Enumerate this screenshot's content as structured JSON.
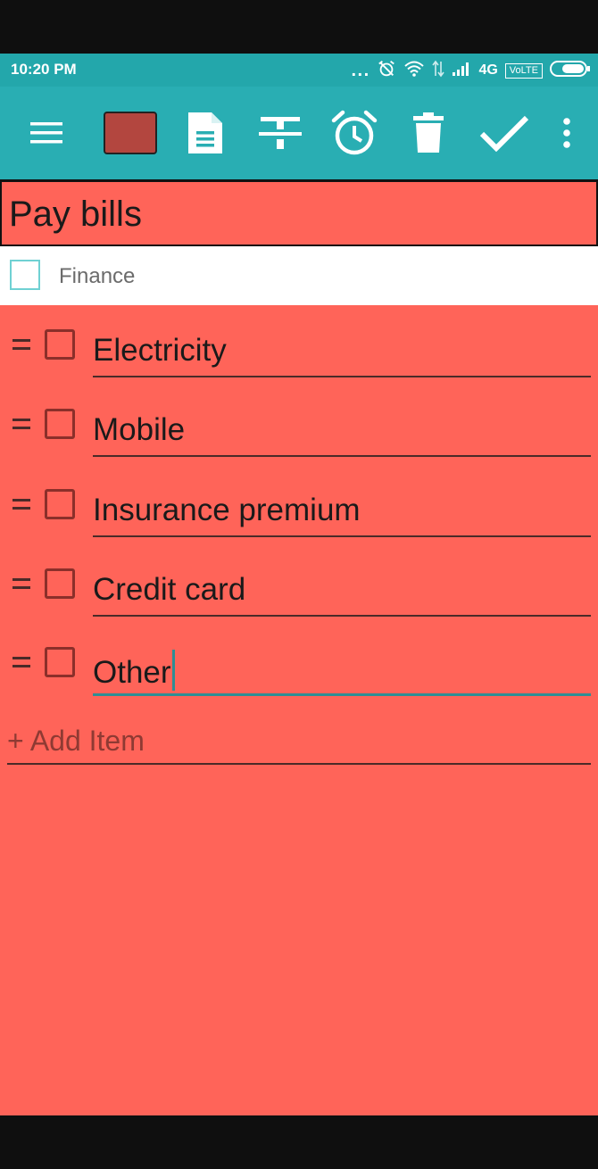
{
  "status_bar": {
    "time": "10:20 PM",
    "more_dots": "...",
    "network_type": "4G",
    "volte": "VoLTE",
    "icons": [
      "alarm-off-icon",
      "wifi-icon",
      "data-arrows-icon",
      "signal-icon",
      "battery-icon"
    ]
  },
  "toolbar": {
    "buttons": [
      "menu-icon",
      "color-picker",
      "document-icon",
      "strikethrough-icon",
      "alarm-icon",
      "delete-icon",
      "check-icon",
      "more-vert-icon"
    ],
    "swatch_color": "#b3463f",
    "background": "#29aeb3"
  },
  "note": {
    "title": "Pay bills",
    "background_color": "#ff6459",
    "category": {
      "label": "Finance",
      "icon": "notebook-icon"
    },
    "items": [
      {
        "text": "Electricity",
        "checked": false
      },
      {
        "text": "Mobile",
        "checked": false
      },
      {
        "text": "Insurance premium",
        "checked": false
      },
      {
        "text": "Credit card",
        "checked": false
      },
      {
        "text": "Other",
        "checked": false,
        "focused": true
      }
    ],
    "add_item_label": "+ Add Item"
  }
}
